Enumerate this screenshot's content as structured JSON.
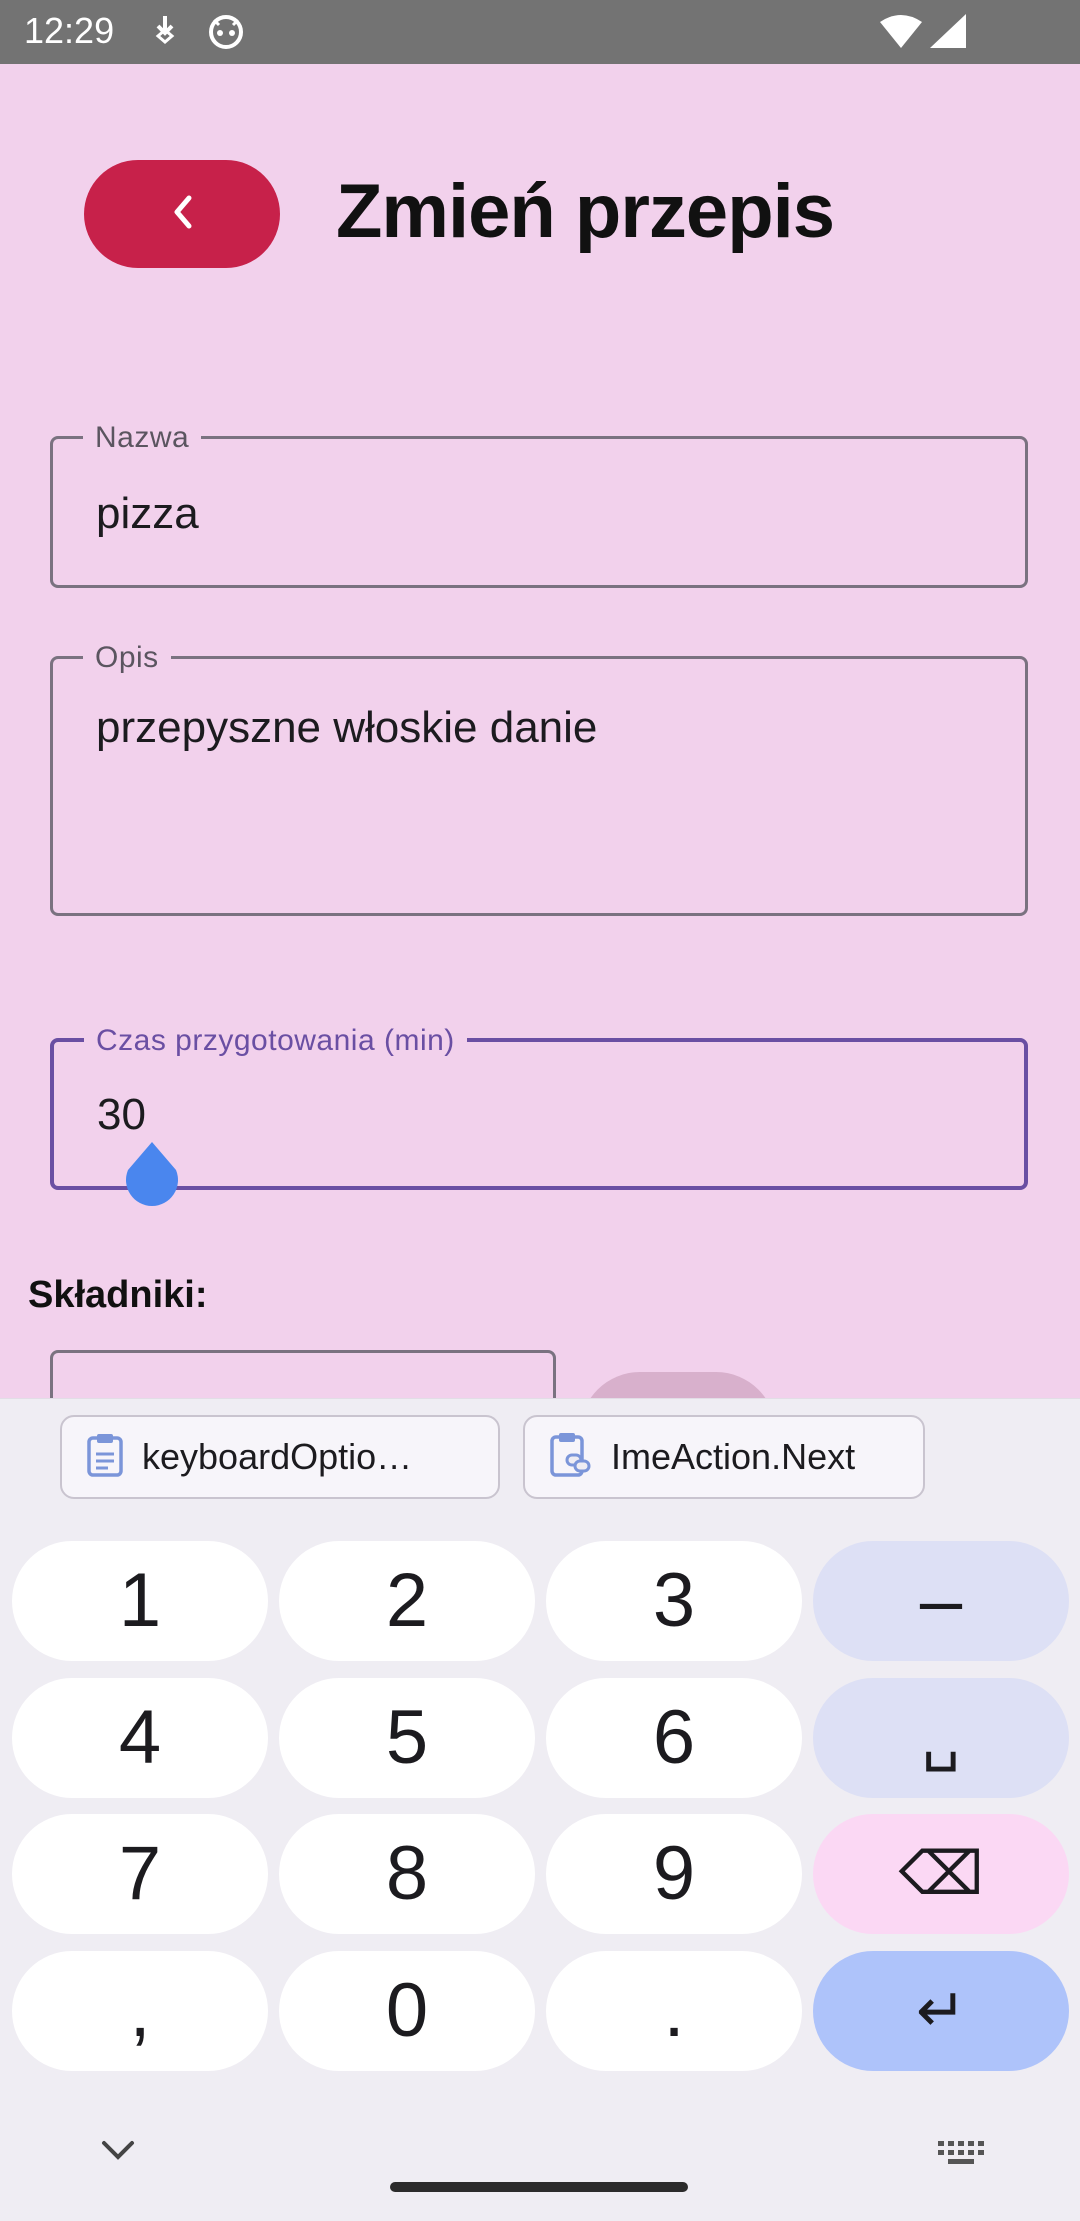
{
  "status_bar": {
    "time": "12:29",
    "icons": [
      "download-icon",
      "android-icon",
      "wifi-icon",
      "signal-icon"
    ]
  },
  "header": {
    "back_icon": "chevron-left-icon",
    "title": "Zmień przepis",
    "back_button_color": "#c7214a"
  },
  "form": {
    "name": {
      "label": "Nazwa",
      "value": "pizza"
    },
    "description": {
      "label": "Opis",
      "value": "przepyszne włoskie danie"
    },
    "prep_time": {
      "label": "Czas przygotowania (min)",
      "value": "30",
      "focused": true
    },
    "ingredients_label": "Składniki:"
  },
  "keyboard": {
    "suggestions": [
      {
        "icon": "clipboard-icon",
        "label": "keyboardOptio…"
      },
      {
        "icon": "clipboard-link-icon",
        "label": "ImeAction.Next"
      }
    ],
    "rows": [
      [
        "1",
        "2",
        "3",
        "–"
      ],
      [
        "4",
        "5",
        "6",
        "␣"
      ],
      [
        "7",
        "8",
        "9",
        "⌫"
      ],
      [
        ",",
        "0",
        ".",
        "↵"
      ]
    ],
    "bottom_icons": [
      "chevron-down-icon",
      "keyboard-icon"
    ]
  },
  "colors": {
    "background": "#f2d1ec",
    "accent": "#6a4fa3",
    "enter_key": "#aec3fa",
    "delete_key": "#fbd8f4",
    "mod_key": "#dde0f5"
  }
}
